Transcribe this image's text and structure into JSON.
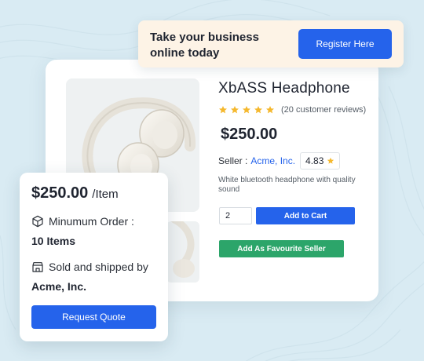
{
  "banner": {
    "text": "Take your business online today",
    "register_label": "Register Here"
  },
  "product": {
    "title": "XbASS Headphone",
    "rating_stars": 5,
    "review_count": "(20 customer reviews)",
    "price": "$250.00",
    "seller_label": "Seller :",
    "seller_name": "Acme, Inc.",
    "seller_rating": "4.83",
    "description": "White bluetooth headphone with quality sound",
    "quantity_value": "2",
    "add_to_cart_label": "Add to Cart",
    "favourite_label": "Add As Favourite Seller"
  },
  "quote": {
    "price": "$250.00",
    "unit": "/Item",
    "min_order_label": "Minumum Order :",
    "min_order_value": "10 Items",
    "sold_by_label": "Sold and shipped by",
    "sold_by_value": "Acme, Inc.",
    "request_label": "Request Quote"
  },
  "colors": {
    "primary": "#2563eb",
    "success": "#2ca56a",
    "star": "#f5b82e",
    "background": "#d9ebf3",
    "banner": "#fdf3e6"
  },
  "icons": {
    "min_order": "box-icon",
    "sold_by": "store-icon",
    "rating": "star-icon"
  }
}
